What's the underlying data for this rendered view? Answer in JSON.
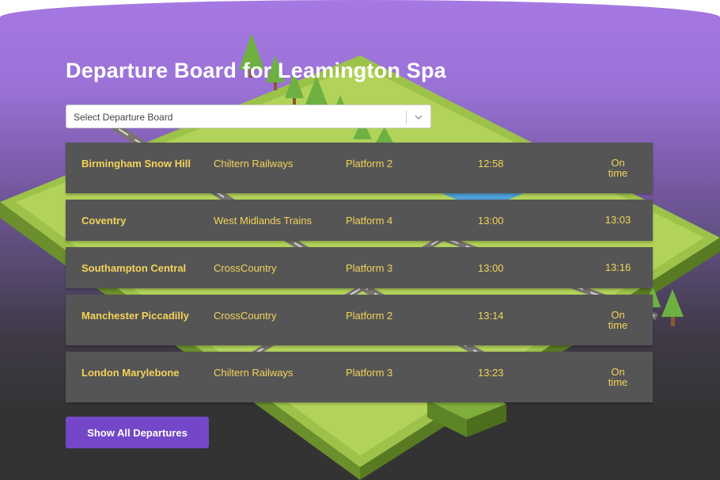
{
  "page": {
    "title": "Departure Board for Leamington Spa"
  },
  "select": {
    "placeholder": "Select Departure Board",
    "icon": "chevron-down-icon"
  },
  "departures": [
    {
      "destination": "Birmingham Snow Hill",
      "operator": "Chiltern Railways",
      "platform": "Platform 2",
      "scheduled": "12:58",
      "expected": "On time"
    },
    {
      "destination": "Coventry",
      "operator": "West Midlands Trains",
      "platform": "Platform 4",
      "scheduled": "13:00",
      "expected": "13:03"
    },
    {
      "destination": "Southampton Central",
      "operator": "CrossCountry",
      "platform": "Platform 3",
      "scheduled": "13:00",
      "expected": "13:16"
    },
    {
      "destination": "Manchester Piccadilly",
      "operator": "CrossCountry",
      "platform": "Platform 2",
      "scheduled": "13:14",
      "expected": "On time"
    },
    {
      "destination": "London Marylebone",
      "operator": "Chiltern Railways",
      "platform": "Platform 3",
      "scheduled": "13:23",
      "expected": "On time"
    }
  ],
  "actions": {
    "show_all_label": "Show All Departures"
  },
  "colors": {
    "accent": "#7447c9",
    "row_text": "#f3d35a",
    "row_bg": "#555555"
  }
}
